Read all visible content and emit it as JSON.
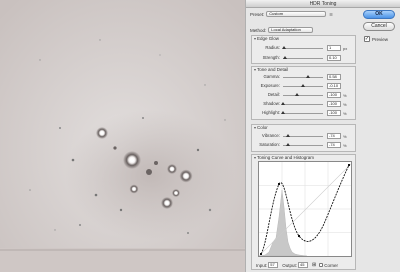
{
  "dialog": {
    "title": "HDR Toning",
    "preset_label": "Preset:",
    "preset_value": "Custom",
    "ok_label": "OK",
    "cancel_label": "Cancel",
    "preview_label": "Preview",
    "preview_checked": true,
    "method_label": "Method:",
    "method_value": "Local Adaptation"
  },
  "edge_glow": {
    "title": "Edge Glow",
    "radius_label": "Radius:",
    "radius_value": "1",
    "radius_unit": "px",
    "radius_level": 0.02,
    "strength_label": "Strength:",
    "strength_value": "0.10",
    "strength_level": 0.05
  },
  "tone_detail": {
    "title": "Tone and Detail",
    "gamma_label": "Gamma:",
    "gamma_value": "0.58",
    "gamma_level": 0.62,
    "exposure_label": "Exposure:",
    "exposure_value": "-0.10",
    "exposure_level": 0.49,
    "detail_label": "Detail:",
    "detail_value": "-100",
    "detail_unit": "%",
    "detail_level": 0.35,
    "shadow_label": "Shadow:",
    "shadow_value": "-100",
    "shadow_unit": "%",
    "shadow_level": 0.0,
    "highlight_label": "Highlight:",
    "highlight_value": "-100",
    "highlight_unit": "%",
    "highlight_level": 0.0
  },
  "color": {
    "title": "Color",
    "vibrance_label": "Vibrance:",
    "vibrance_value": "-74",
    "vibrance_unit": "%",
    "vibrance_level": 0.13,
    "saturation_label": "Saturation:",
    "saturation_value": "-74",
    "saturation_unit": "%",
    "saturation_level": 0.13
  },
  "curve": {
    "title": "Toning Curve and Histogram",
    "input_label": "Input:",
    "input_value": "57",
    "output_label": "Output:",
    "output_value": "45",
    "corner_label": "Corner"
  }
}
